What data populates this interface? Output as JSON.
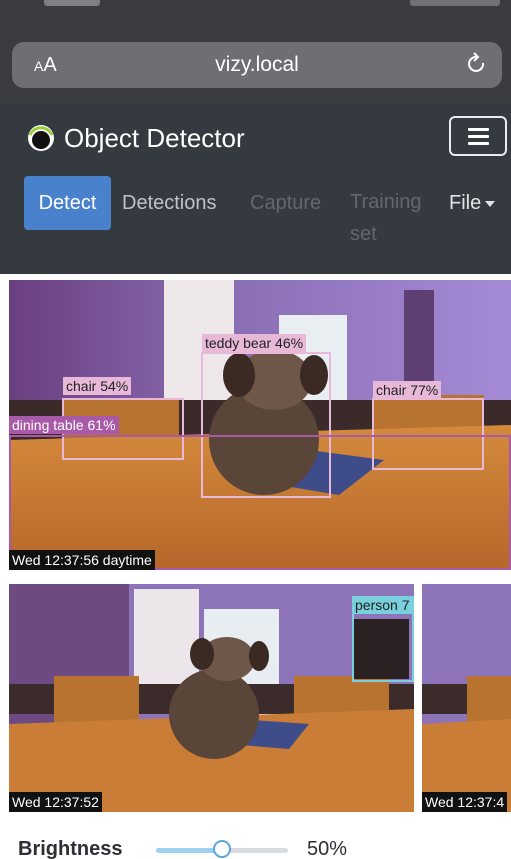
{
  "browser": {
    "text_size_label": "AA",
    "url": "vizy.local"
  },
  "app": {
    "title": "Object Detector",
    "nav": {
      "detect": "Detect",
      "detections": "Detections",
      "capture": "Capture",
      "training_set": "Training set",
      "file": "File"
    }
  },
  "main_image": {
    "timestamp": "Wed 12:37:56 daytime",
    "detections": [
      {
        "label": "teddy bear 46%"
      },
      {
        "label": "chair 54%"
      },
      {
        "label": "chair 77%"
      },
      {
        "label": "dining table 61%"
      }
    ]
  },
  "thumbnails": [
    {
      "timestamp": "Wed 12:37:52",
      "detection": "person 7"
    },
    {
      "timestamp": "Wed 12:37:4"
    }
  ],
  "controls": {
    "brightness_label": "Brightness",
    "brightness_value": "50%",
    "brightness_fraction": 0.5
  },
  "colors": {
    "navbar": "#343a40",
    "active_tab": "#4a81cc",
    "detection_box": "#e7b8d7",
    "table_box": "#a85aa9",
    "person_box": "#79d0dc"
  }
}
